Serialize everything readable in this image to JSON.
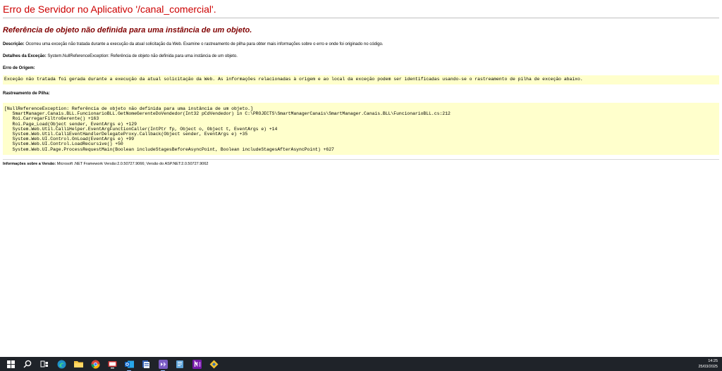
{
  "page_title": "Erro de Servidor no Aplicativo '/canal_comercial'.",
  "error_message": "Referência de objeto não definida para uma instância de um objeto.",
  "description": {
    "label": "Descrição:",
    "text": "Ocorreu uma exceção não tratada durante a execução da atual solicitação da Web. Examine o rastreamento de pilha para obter mais informações sobre o erro e onde foi originado no código."
  },
  "exception_details": {
    "label": "Detalhes da Exceção:",
    "text": "System.NullReferenceException: Referência de objeto não definida para uma instância de um objeto."
  },
  "source_error": {
    "label": "Erro de Origem:",
    "text": "Exceção não tratada foi gerada durante a execução da atual solicitação da Web. As informações relacionadas à origem e ao local da exceção podem ser identificadas usando-se o rastreamento de pilha de exceção abaixo."
  },
  "stack_trace": {
    "label": "Rastreamento de Pilha:",
    "lines": [
      "[NullReferenceException: Referência de objeto não definida para uma instância de um objeto.]",
      "   SmartManager.Canais.BLL.FuncionarioBLL.GetNomeGerenteDoVendedor(Int32 pCdVendedor) in C:\\PROJECTS\\SmartManagerCanais\\SmartManager.Canais.BLL\\FuncionarioBLL.cs:212",
      "   Roi.CarregarFiltroGerente() +163",
      "   Roi.Page_Load(Object sender, EventArgs e) +129",
      "   System.Web.Util.CalliHelper.EventArgFunctionCaller(IntPtr fp, Object o, Object t, EventArgs e) +14",
      "   System.Web.Util.CalliEventHandlerDelegateProxy.Callback(Object sender, EventArgs e) +35",
      "   System.Web.UI.Control.OnLoad(EventArgs e) +99",
      "   System.Web.UI.Control.LoadRecursive() +50",
      "   System.Web.UI.Page.ProcessRequestMain(Boolean includeStagesBeforeAsyncPoint, Boolean includeStagesAfterAsyncPoint) +627"
    ]
  },
  "version_info": {
    "label": "Informações sobre a Versão:",
    "text": "Microsoft .NET Framework Versão:2.0.50727.9066; Versão do ASP.NET:2.0.50727.9062"
  },
  "taskbar": {
    "clock_time": "14:25",
    "clock_date": "25/03/2025",
    "icons": [
      "windows-start-icon",
      "search-icon",
      "task-view-icon",
      "edge-browser-icon",
      "file-explorer-icon",
      "chrome-browser-icon",
      "remote-app-icon",
      "outlook-icon",
      "database-app-icon",
      "visual-studio-icon",
      "notepad-app-icon",
      "onenote-icon",
      "sql-tool-icon"
    ]
  },
  "colors": {
    "title_red": "#cc0000",
    "subtitle_maroon": "#800000",
    "code_background": "#ffffcc",
    "taskbar_background": "#1f2329"
  }
}
